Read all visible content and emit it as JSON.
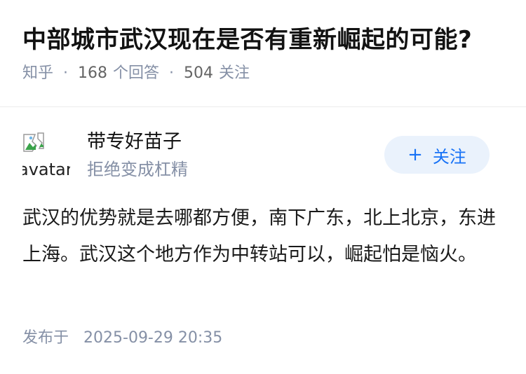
{
  "question": {
    "title": "中部城市武汉现在是否有重新崛起的可能?",
    "source": "知乎",
    "answer_count": "168",
    "answer_label": "个回答",
    "follower_count": "504",
    "follower_label": "关注",
    "separator": "·"
  },
  "author": {
    "avatar_alt": "avatar",
    "avatar_icon": "broken-image-icon",
    "name": "带专好苗子",
    "bio": "拒绝变成杠精",
    "follow_label": "关注",
    "follow_icon": "+"
  },
  "answer": {
    "content": "武汉的优势就是去哪都方便，南下广东，北上北京，东进上海。武汉这个地方作为中转站可以，崛起怕是恼火。",
    "published_label": "发布于",
    "published_time": "2025-09-29 20:35"
  },
  "colors": {
    "title": "#121212",
    "meta": "#8590a6",
    "follow_bg": "#eaf2fc",
    "follow_text": "#1772f6",
    "divider": "#ebebeb"
  }
}
